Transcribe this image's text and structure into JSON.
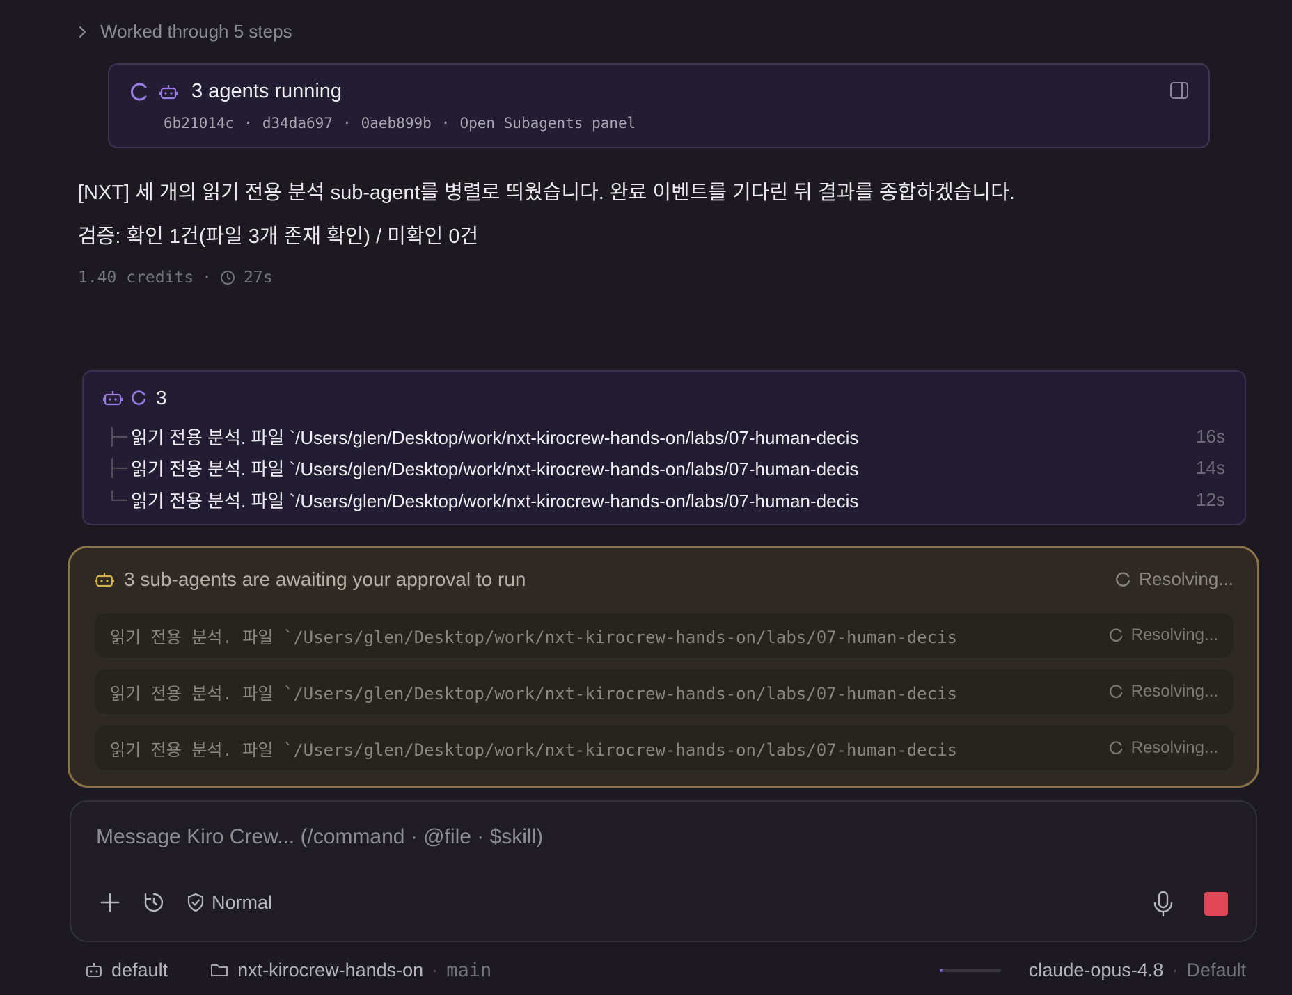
{
  "steps": {
    "label": "Worked through 5 steps"
  },
  "agents_card": {
    "title": "3 agents running",
    "ids": [
      "6b21014c",
      "d34da697",
      "0aeb899b"
    ],
    "separator": "·",
    "link": "Open Subagents panel"
  },
  "message": {
    "line1": "[NXT] 세 개의 읽기 전용 분석 sub-agent를 병렬로 띄웠습니다. 완료 이벤트를 기다린 뒤 결과를 종합하겠습니다.",
    "line2": "검증: 확인 1건(파일 3개 존재 확인) / 미확인 0건",
    "credits": "1.40 credits",
    "separator": "·",
    "duration": "27s"
  },
  "subagents": {
    "count": "3",
    "items": [
      {
        "tree": "├─",
        "text": "읽기 전용 분석. 파일 `/Users/glen/Desktop/work/nxt-kirocrew-hands-on/labs/07-human-decis",
        "time": "16s"
      },
      {
        "tree": "├─",
        "text": "읽기 전용 분석. 파일 `/Users/glen/Desktop/work/nxt-kirocrew-hands-on/labs/07-human-decis",
        "time": "14s"
      },
      {
        "tree": "└─",
        "text": "읽기 전용 분석. 파일 `/Users/glen/Desktop/work/nxt-kirocrew-hands-on/labs/07-human-decis",
        "time": "12s"
      }
    ]
  },
  "approval": {
    "title": "3 sub-agents are awaiting your approval to run",
    "status": "Resolving...",
    "items": [
      {
        "text": "읽기 전용 분석. 파일 `/Users/glen/Desktop/work/nxt-kirocrew-hands-on/labs/07-human-decis",
        "status": "Resolving..."
      },
      {
        "text": "읽기 전용 분석. 파일 `/Users/glen/Desktop/work/nxt-kirocrew-hands-on/labs/07-human-decis",
        "status": "Resolving..."
      },
      {
        "text": "읽기 전용 분석. 파일 `/Users/glen/Desktop/work/nxt-kirocrew-hands-on/labs/07-human-decis",
        "status": "Resolving..."
      }
    ]
  },
  "input": {
    "placeholder": "Message Kiro Crew... (/command · @file · $skill)",
    "mode": "Normal"
  },
  "footer": {
    "agent": "default",
    "folder": "nxt-kirocrew-hands-on",
    "branch": "main",
    "separator": "·",
    "context_usage": 0.05,
    "model": "claude-opus-4.8",
    "profile": "Default"
  },
  "colors": {
    "accent": "#9a7ee6",
    "approval_border": "#8a7548",
    "stop": "#e0485a",
    "background": "#1c1a20"
  }
}
